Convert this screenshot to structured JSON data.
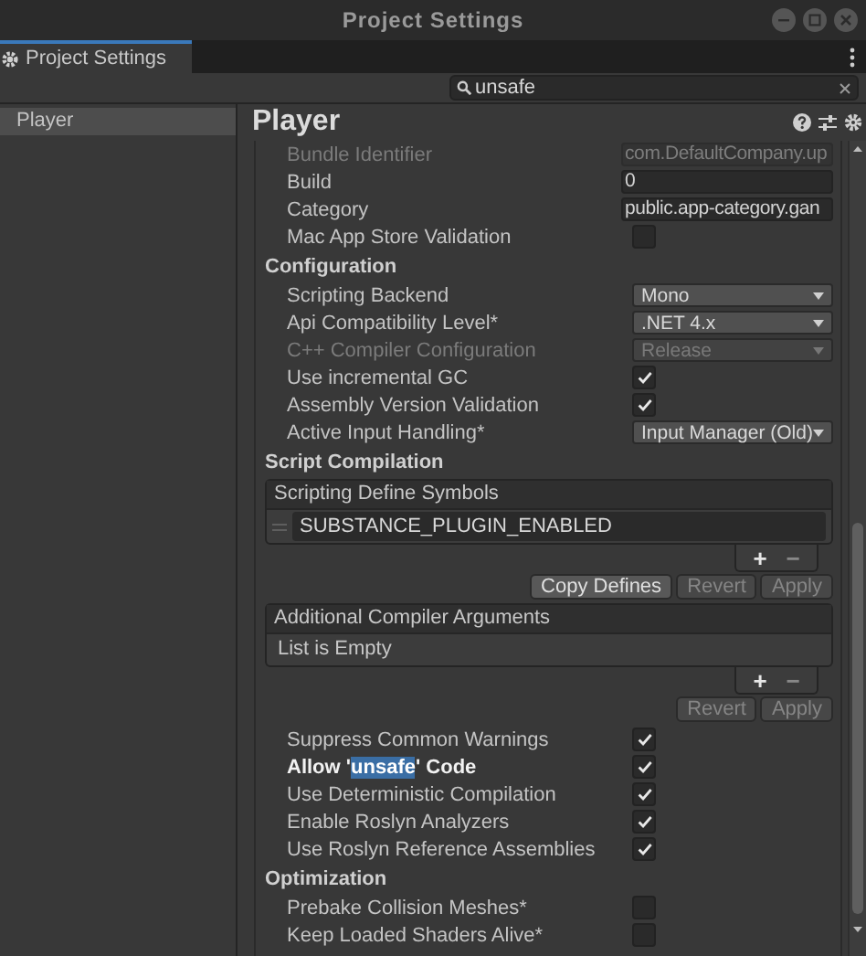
{
  "window": {
    "title": "Project Settings"
  },
  "tab": {
    "label": "Project Settings",
    "selected": true
  },
  "search": {
    "value": "unsafe"
  },
  "sidebar": {
    "items": [
      {
        "label": "Player",
        "selected": true
      }
    ]
  },
  "inspector": {
    "title": "Player",
    "rows": [
      {
        "kind": "field",
        "label": "Bundle Identifier",
        "value": "com.DefaultCompany.up",
        "disabled": true
      },
      {
        "kind": "field",
        "label": "Build",
        "value": "0",
        "disabled": false
      },
      {
        "kind": "field",
        "label": "Category",
        "value": "public.app-category.gan",
        "disabled": false
      },
      {
        "kind": "checkbox",
        "label": "Mac App Store Validation",
        "checked": false,
        "matched": false
      },
      {
        "kind": "section",
        "label": "Configuration"
      },
      {
        "kind": "dropdown",
        "label": "Scripting Backend",
        "value": "Mono",
        "disabled": false
      },
      {
        "kind": "dropdown",
        "label": "Api Compatibility Level*",
        "value": ".NET 4.x",
        "disabled": false
      },
      {
        "kind": "dropdown",
        "label": "C++ Compiler Configuration",
        "value": "Release",
        "disabled": true
      },
      {
        "kind": "checkbox",
        "label": "Use incremental GC",
        "checked": true,
        "matched": false
      },
      {
        "kind": "checkbox",
        "label": "Assembly Version Validation",
        "checked": true,
        "matched": false
      },
      {
        "kind": "dropdown",
        "label": "Active Input Handling*",
        "value": "Input Manager (Old)",
        "disabled": false
      },
      {
        "kind": "section",
        "label": "Script Compilation"
      },
      {
        "kind": "list",
        "title": "Scripting Define Symbols",
        "entries": [
          "SUBSTANCE_PLUGIN_ENABLED"
        ],
        "add": "+",
        "remove": "−"
      },
      {
        "kind": "buttons",
        "buttons": [
          {
            "label": "Copy Defines",
            "disabled": false
          },
          {
            "label": "Revert",
            "disabled": true
          },
          {
            "label": "Apply",
            "disabled": true
          }
        ]
      },
      {
        "kind": "list",
        "title": "Additional Compiler Arguments",
        "empty_text": "List is Empty",
        "add": "+",
        "remove": "−"
      },
      {
        "kind": "buttons",
        "buttons": [
          {
            "label": "Revert",
            "disabled": true
          },
          {
            "label": "Apply",
            "disabled": true
          }
        ]
      },
      {
        "kind": "checkbox",
        "label": "Suppress Common Warnings",
        "checked": true,
        "matched": false
      },
      {
        "kind": "checkbox",
        "label_parts": [
          {
            "text": "Allow '",
            "highlight": false
          },
          {
            "text": "unsafe",
            "highlight": true
          },
          {
            "text": "' Code",
            "highlight": false
          }
        ],
        "checked": true,
        "matched": true
      },
      {
        "kind": "checkbox",
        "label": "Use Deterministic Compilation",
        "checked": true,
        "matched": false
      },
      {
        "kind": "checkbox",
        "label": "Enable Roslyn Analyzers",
        "checked": true,
        "matched": false
      },
      {
        "kind": "checkbox",
        "label": "Use Roslyn Reference Assemblies",
        "checked": true,
        "matched": false
      },
      {
        "kind": "section",
        "label": "Optimization"
      },
      {
        "kind": "checkbox",
        "label": "Prebake Collision Meshes*",
        "checked": false,
        "matched": false
      },
      {
        "kind": "checkbox",
        "label": "Keep Loaded Shaders Alive*",
        "checked": false,
        "matched": false
      }
    ]
  }
}
